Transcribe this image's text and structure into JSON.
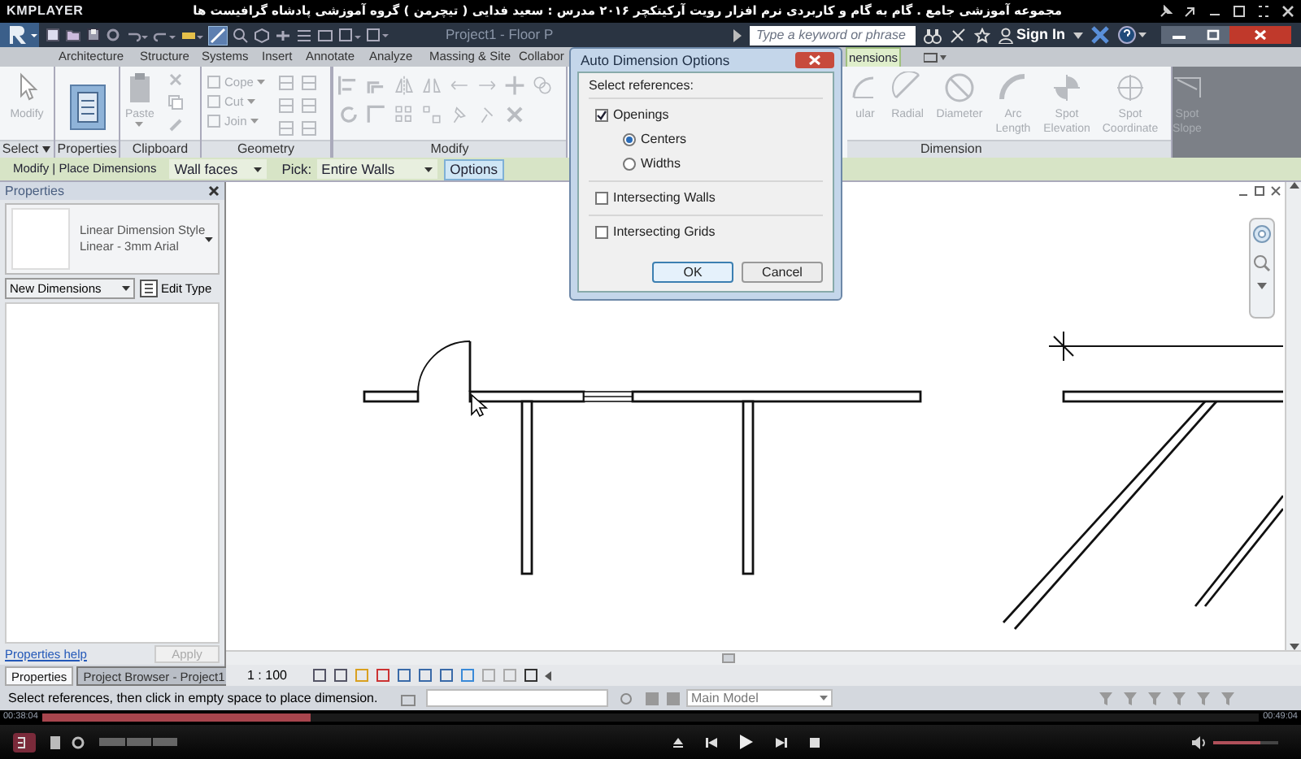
{
  "player": {
    "title": "KMPLAYER",
    "caption": "مجموعه آموزشی جامع . گام به گام و کاربردی نرم افزار رویت آرکیتکچر ۲۰۱۶   مدرس : سعید فدایی ( تیچرمن ) گروه آموزشی پادشاه گرافیست ها",
    "elapsed": "00:38:04",
    "total": "00:49:04",
    "progress": {
      "level": 0.22
    },
    "volume": {
      "level": 0.72
    }
  },
  "app": {
    "doc_title": "Project1 - Floor P",
    "search": {
      "placeholder": "Type a keyword or phrase"
    },
    "sign_in": "Sign In"
  },
  "ribbon_tabs": [
    {
      "label": "Architecture",
      "selected": false
    },
    {
      "label": "Structure",
      "selected": false
    },
    {
      "label": "Systems",
      "selected": false
    },
    {
      "label": "Insert",
      "selected": false
    },
    {
      "label": "Annotate",
      "selected": false
    },
    {
      "label": "Analyze",
      "selected": false
    },
    {
      "label": "Massing & Site",
      "selected": false
    },
    {
      "label": "Collabor",
      "selected": false
    },
    {
      "label": "nensions",
      "selected": true
    }
  ],
  "ribbon_panels": [
    {
      "label": "Select",
      "tools": [
        {
          "label": "Modify",
          "kind": "large"
        }
      ]
    },
    {
      "label": "Properties",
      "tools": [
        {
          "kind": "properties"
        }
      ]
    },
    {
      "label": "Clipboard",
      "tools": [
        {
          "label": "Paste",
          "kind": "large"
        }
      ]
    },
    {
      "label": "Geometry",
      "tools": [
        {
          "label": "Cope",
          "kind": "small"
        },
        {
          "label": "Cut",
          "kind": "small"
        },
        {
          "label": "Join",
          "kind": "small"
        }
      ]
    },
    {
      "label": "Modify"
    },
    {
      "label": "Dimension",
      "tools": [
        {
          "label": "ular",
          "kind": "large"
        },
        {
          "label": "Radial",
          "kind": "large"
        },
        {
          "label": "Diameter",
          "kind": "large"
        },
        {
          "label": "Arc Length",
          "kind": "large"
        },
        {
          "label": "Spot Elevation",
          "kind": "large"
        },
        {
          "label": "Spot Coordinate",
          "kind": "large"
        },
        {
          "label": "Spot Slope",
          "kind": "large"
        }
      ]
    }
  ],
  "options_bar": {
    "context": "Modify | Place Dimensions",
    "reference": "Wall faces",
    "pick_label": "Pick:",
    "pick": "Entire Walls",
    "options_button": "Options"
  },
  "properties": {
    "title": "Properties",
    "type_name": "Linear Dimension Style",
    "type_sub": "Linear - 3mm Arial",
    "filter": "New Dimensions",
    "edit_type": "Edit Type",
    "help": "Properties help",
    "apply": "Apply",
    "tabs": [
      {
        "label": "Properties",
        "selected": true
      },
      {
        "label": "Project Browser - Project1",
        "selected": false
      }
    ]
  },
  "view_bar": {
    "scale": "1 : 100"
  },
  "status_bar": {
    "message": "Select references, then click in empty space to place dimension.",
    "model": "Main Model"
  },
  "dialog": {
    "title": "Auto Dimension Options",
    "group_label": "Select references:",
    "options": [
      {
        "label": "Openings",
        "kind": "checkbox",
        "checked": true,
        "children": [
          {
            "label": "Centers",
            "kind": "radio",
            "selected": true
          },
          {
            "label": "Widths",
            "kind": "radio",
            "selected": false
          }
        ]
      },
      {
        "label": "Intersecting Walls",
        "kind": "checkbox",
        "checked": false
      },
      {
        "label": "Intersecting Grids",
        "kind": "checkbox",
        "checked": false
      }
    ],
    "buttons": [
      "OK",
      "Cancel"
    ]
  }
}
